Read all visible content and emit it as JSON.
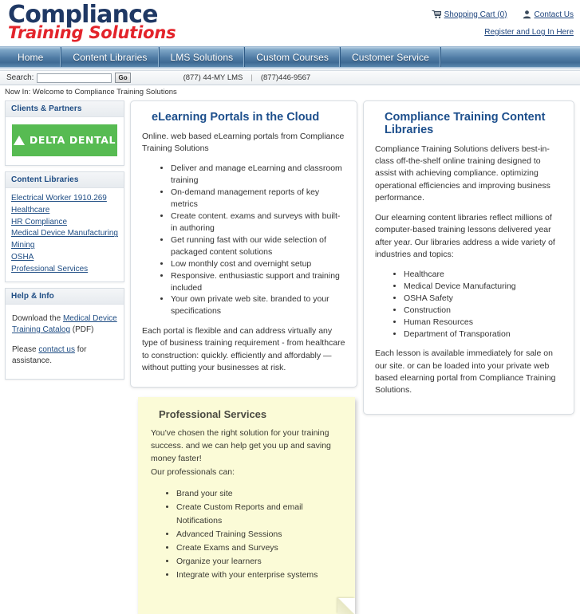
{
  "header": {
    "logo_line1": "Compliance",
    "logo_line2": "Training Solutions",
    "shopping_cart_label": "Shopping Cart (0)",
    "contact_us_label": "Contact Us",
    "register_login_label": "Register and Log In Here",
    "cart_icon": "shopping-cart-icon",
    "contact_icon": "user-contact-icon"
  },
  "nav": {
    "items": [
      {
        "label": "Home"
      },
      {
        "label": "Content Libraries"
      },
      {
        "label": "LMS Solutions"
      },
      {
        "label": "Custom Courses"
      },
      {
        "label": "Customer Service"
      }
    ]
  },
  "search": {
    "label": "Search:",
    "value": "",
    "placeholder": "",
    "go_label": "Go",
    "phone1": "(877) 44-MY LMS",
    "separator": "|",
    "phone2": "(877)446-9567"
  },
  "breadcrumb": {
    "text": "Now In: Welcome to Compliance Training Solutions"
  },
  "sidebar": {
    "clients_partners": {
      "title": "Clients & Partners",
      "logo_text": "DELTA DENTAL"
    },
    "content_libraries": {
      "title": "Content Libraries",
      "links": [
        "Electrical Worker 1910.269",
        "Healthcare",
        "HR Compliance",
        "Medical Device Manufacturing",
        "Mining",
        "OSHA",
        "Professional Services"
      ]
    },
    "help_info": {
      "title": "Help & Info",
      "line1_pre": "Download the ",
      "line1_link": "Medical Device Training Catalog",
      "line1_post": " (PDF)",
      "line2_pre": "Please ",
      "line2_link": "contact us",
      "line2_post": " for assistance."
    }
  },
  "elearning_card": {
    "title": "eLearning Portals in the Cloud",
    "intro": "Online. web based eLearning portals from Compliance Training Solutions",
    "bullets": [
      "Deliver and manage eLearning and classroom training",
      "On-demand management reports of key metrics",
      "Create content. exams and surveys with built-in authoring",
      "Get running fast with our wide selection of packaged content solutions",
      "Low monthly cost and overnight setup",
      "Responsive. enthusiastic support and training included",
      "Your own private web site. branded to your specifications"
    ],
    "outro": "Each portal is flexible and can address virtually any type of business training requirement - from healthcare to construction: quickly. efficiently and affordably — without putting your businesses at risk."
  },
  "professional_services_note": {
    "title": "Professional Services",
    "para1": "You've chosen the right solution for your training success. and we can help get you up and saving money faster!",
    "para2": "Our professionals can:",
    "bullets": [
      "Brand your site",
      "Create Custom Reports and email Notifications",
      "Advanced Training Sessions",
      "Create Exams and Surveys",
      "Organize your learners",
      "Integrate with your enterprise systems"
    ]
  },
  "content_libraries_card": {
    "title": "Compliance Training Content Libraries",
    "para1": "Compliance Training Solutions delivers best-in-class off-the-shelf online training designed to assist with achieving compliance. optimizing operational efficiencies and improving business performance.",
    "para2": "Our elearning content libraries reflect millions of computer-based training lessons delivered year after year. Our libraries address a wide variety of industries and topics:",
    "bullets": [
      "Healthcare",
      "Medical Device Manufacturing",
      "OSHA Safety",
      "Construction",
      "Human Resources",
      "Department of Transporation"
    ],
    "para3": "Each lesson is available immediately for sale on our site. or can be loaded into your private web based elearning portal from Compliance Training Solutions."
  },
  "colors": {
    "brand_navy": "#1f3864",
    "brand_red": "#e3242b",
    "nav_blue": "#4f7ba4",
    "heading_blue": "#1d4f8c",
    "delta_green": "#57bb52",
    "sticky_yellow": "#fbfbd7"
  }
}
